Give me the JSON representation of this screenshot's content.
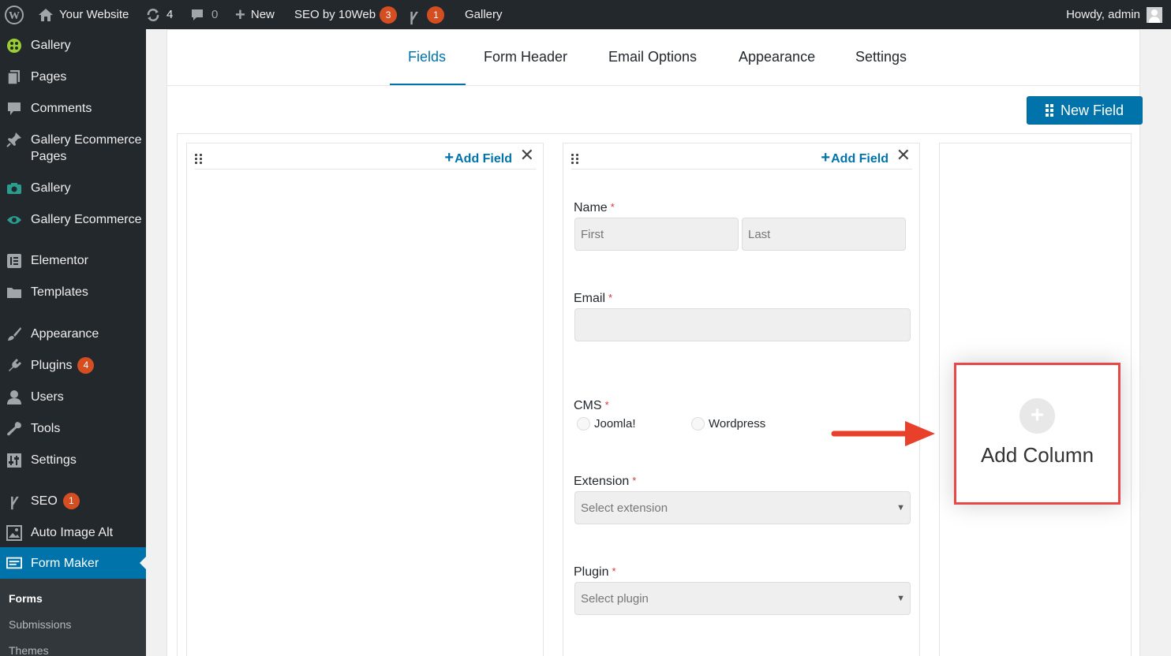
{
  "adminbar": {
    "site_name": "Your Website",
    "updates_count": "4",
    "comments_count": "0",
    "new_label": "New",
    "seo_label": "SEO by 10Web",
    "seo_badge": "3",
    "yoast_badge": "1",
    "gallery_label": "Gallery",
    "howdy": "Howdy, admin"
  },
  "sidebar": {
    "items": [
      {
        "label": "Gallery",
        "icon": "gallery-icon"
      },
      {
        "label": "Pages",
        "icon": "pages-icon"
      },
      {
        "label": "Comments",
        "icon": "comments-icon"
      },
      {
        "label": "Gallery Ecommerce Pages",
        "icon": "pin-icon"
      },
      {
        "label": "Gallery",
        "icon": "camera-icon"
      },
      {
        "label": "Gallery Ecommerce",
        "icon": "eye-icon"
      },
      {
        "label": "Elementor",
        "icon": "elementor-icon"
      },
      {
        "label": "Templates",
        "icon": "folder-icon"
      },
      {
        "label": "Appearance",
        "icon": "brush-icon"
      },
      {
        "label": "Plugins",
        "icon": "plugin-icon",
        "badge": "4"
      },
      {
        "label": "Users",
        "icon": "user-icon"
      },
      {
        "label": "Tools",
        "icon": "wrench-icon"
      },
      {
        "label": "Settings",
        "icon": "settings-icon"
      },
      {
        "label": "SEO",
        "icon": "yoast-icon",
        "badge": "1"
      },
      {
        "label": "Auto Image Alt",
        "icon": "image-alt-icon"
      },
      {
        "label": "Form Maker",
        "icon": "form-icon"
      }
    ],
    "submenu": [
      "Forms",
      "Submissions",
      "Themes"
    ]
  },
  "tabs": [
    "Fields",
    "Form Header",
    "Email Options",
    "Appearance",
    "Settings"
  ],
  "new_field_label": "New Field",
  "column": {
    "add_field_label": "Add Field",
    "close_glyph": "✕"
  },
  "fields": {
    "name": {
      "label": "Name",
      "first_placeholder": "First",
      "last_placeholder": "Last"
    },
    "email": {
      "label": "Email"
    },
    "cms": {
      "label": "CMS",
      "options": [
        "Joomla!",
        "Wordpress"
      ]
    },
    "extension": {
      "label": "Extension",
      "placeholder": "Select extension"
    },
    "plugin": {
      "label": "Plugin",
      "placeholder": "Select plugin"
    },
    "required_mark": "*"
  },
  "add_column_label": "Add Column",
  "colors": {
    "accent": "#0073aa",
    "highlight": "#e84848",
    "arrow": "#e8402a"
  }
}
